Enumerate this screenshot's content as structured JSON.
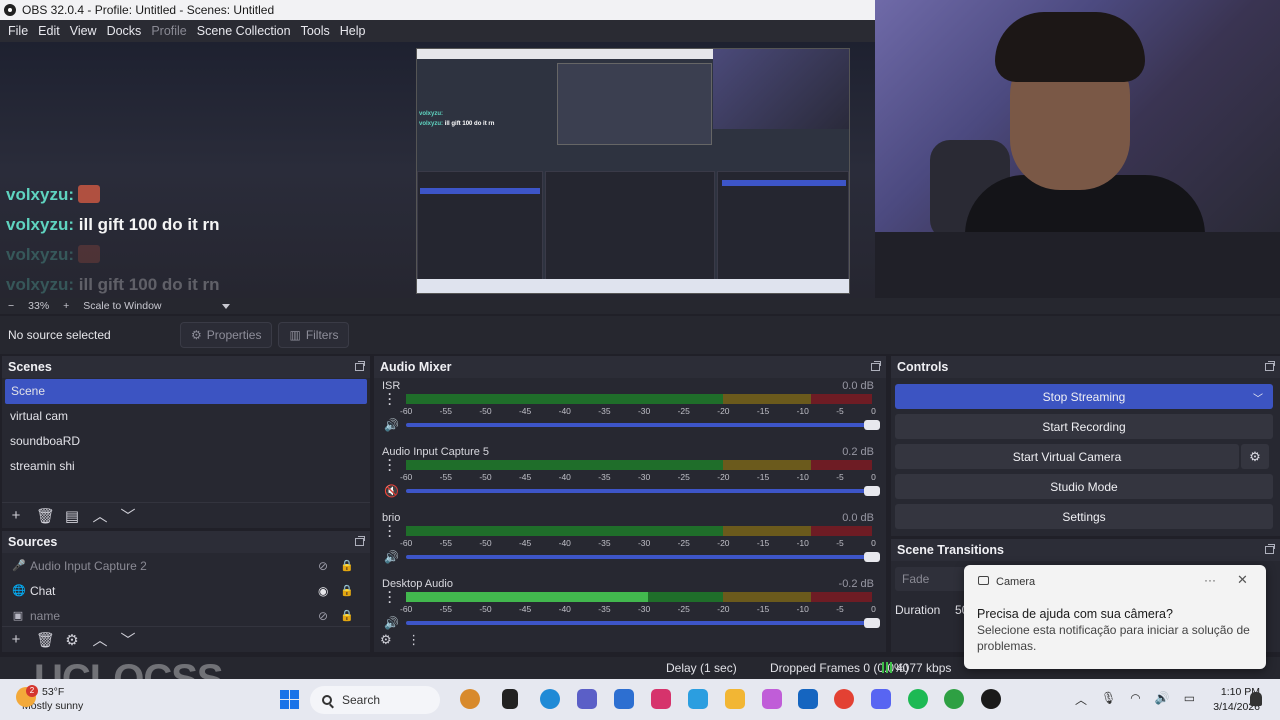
{
  "window": {
    "title": "OBS 32.0.4 - Profile: Untitled - Scenes: Untitled"
  },
  "menu": {
    "file": "File",
    "edit": "Edit",
    "view": "View",
    "docks": "Docks",
    "profile": "Profile",
    "scene_collection": "Scene Collection",
    "tools": "Tools",
    "help": "Help"
  },
  "preview": {
    "chat": [
      {
        "user": "volxyzu:",
        "msg": ""
      },
      {
        "user": "volxyzu:",
        "msg": "ill gift 100 do it rn"
      },
      {
        "user": "volxyzu:",
        "msg": ""
      },
      {
        "user": "volxyzu:",
        "msg": "ill gift 100 do it rn"
      }
    ],
    "nested_chat": [
      {
        "user": "volxyzu:",
        "msg": ""
      },
      {
        "user": "volxyzu:",
        "msg": "ill gift 100 do it rn"
      }
    ]
  },
  "zoom": {
    "minus": "−",
    "value": "33%",
    "plus": "+",
    "mode": "Scale to Window"
  },
  "context": {
    "no_source": "No source selected",
    "properties": "Properties",
    "filters": "Filters"
  },
  "scenes": {
    "title": "Scenes",
    "items": [
      "Scene",
      "virtual cam",
      "soundboaRD",
      "streamin shi"
    ],
    "selected_index": 0
  },
  "sources": {
    "title": "Sources",
    "items": [
      {
        "label": "Audio Input Capture 2",
        "icon": "microphone-icon",
        "visible": false
      },
      {
        "label": "Chat",
        "icon": "browser-globe-icon",
        "visible": true
      },
      {
        "label": "name",
        "icon": "image-icon",
        "visible": false
      }
    ]
  },
  "mixer": {
    "title": "Audio Mixer",
    "ticks": [
      "-60",
      "-55",
      "-50",
      "-45",
      "-40",
      "-35",
      "-30",
      "-25",
      "-20",
      "-15",
      "-10",
      "-5",
      "0"
    ],
    "channels": [
      {
        "name": "ISR",
        "db": "0.0 dB",
        "level": 0.0,
        "muted": false,
        "fader": 1.0
      },
      {
        "name": "Audio Input Capture 5",
        "db": "0.2 dB",
        "level": 0.0,
        "muted": true,
        "fader": 1.0
      },
      {
        "name": "brio",
        "db": "0.0 dB",
        "level": 0.0,
        "muted": false,
        "fader": 1.0
      },
      {
        "name": "Desktop Audio",
        "db": "-0.2 dB",
        "level": 0.52,
        "muted": false,
        "fader": 1.0
      }
    ]
  },
  "controls": {
    "title": "Controls",
    "stop_streaming": "Stop Streaming",
    "start_recording": "Start Recording",
    "start_virtual_camera": "Start Virtual Camera",
    "studio_mode": "Studio Mode",
    "settings": "Settings"
  },
  "transitions": {
    "title": "Scene Transitions",
    "type": "Fade",
    "duration_label": "Duration",
    "duration_value": "50"
  },
  "status": {
    "delay": "Delay (1 sec)",
    "dropped": "Dropped Frames 0 (0.0%)",
    "bitrate": "4077 kbps"
  },
  "toast": {
    "app": "Camera",
    "title": "Precisa de ajuda com sua câmera?",
    "body": "Selecione esta notificação para iniciar a solução de problemas.",
    "more": "···",
    "close": "✕"
  },
  "taskbar": {
    "weather_temp": "53°F",
    "weather_desc": "Mostly sunny",
    "weather_badge": "2",
    "search": "Search",
    "time": "1:10 PM",
    "date": "3/14/2026"
  },
  "watermark": "UCLOCSS",
  "colors": {
    "accent": "#3c54c2",
    "chat_user": "#5fd4c0",
    "meter_green": "#42b84e",
    "meter_red": "#6e1c24"
  }
}
